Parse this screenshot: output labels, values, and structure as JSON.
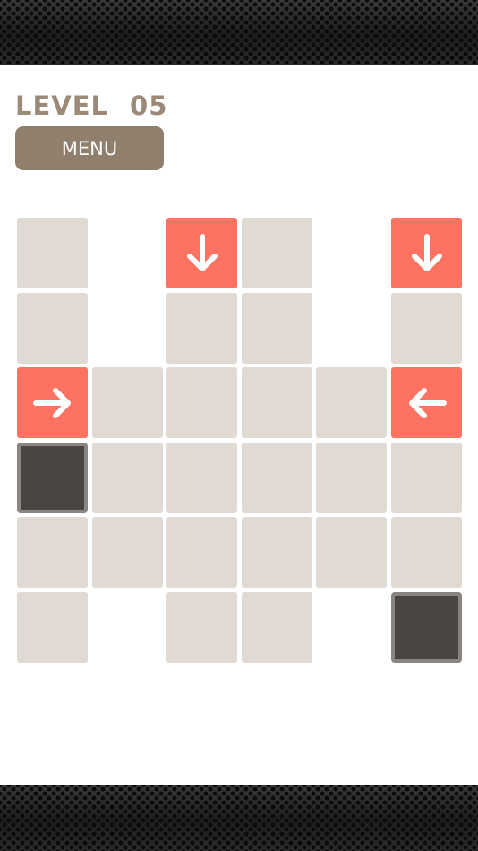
{
  "header": {
    "level_label": "LEVEL",
    "level_number": "05",
    "menu_label": "MENU"
  },
  "colors": {
    "empty_tile": "#e1dad3",
    "arrow_tile": "#fd7260",
    "dark_tile": "#4a4542",
    "text_brown": "#9b8a78",
    "menu_button": "#8f7f6c"
  },
  "board": {
    "cols": 6,
    "rows": 6,
    "tiles": [
      {
        "row": 0,
        "col": 0,
        "type": "empty"
      },
      {
        "row": 0,
        "col": 2,
        "type": "arrow",
        "direction": "down"
      },
      {
        "row": 0,
        "col": 3,
        "type": "empty"
      },
      {
        "row": 0,
        "col": 5,
        "type": "arrow",
        "direction": "down"
      },
      {
        "row": 1,
        "col": 0,
        "type": "empty"
      },
      {
        "row": 1,
        "col": 2,
        "type": "empty"
      },
      {
        "row": 1,
        "col": 3,
        "type": "empty"
      },
      {
        "row": 1,
        "col": 5,
        "type": "empty"
      },
      {
        "row": 2,
        "col": 0,
        "type": "arrow",
        "direction": "right"
      },
      {
        "row": 2,
        "col": 1,
        "type": "empty"
      },
      {
        "row": 2,
        "col": 2,
        "type": "empty"
      },
      {
        "row": 2,
        "col": 3,
        "type": "empty"
      },
      {
        "row": 2,
        "col": 4,
        "type": "empty"
      },
      {
        "row": 2,
        "col": 5,
        "type": "arrow",
        "direction": "left"
      },
      {
        "row": 3,
        "col": 0,
        "type": "dark"
      },
      {
        "row": 3,
        "col": 1,
        "type": "empty"
      },
      {
        "row": 3,
        "col": 2,
        "type": "empty"
      },
      {
        "row": 3,
        "col": 3,
        "type": "empty"
      },
      {
        "row": 3,
        "col": 4,
        "type": "empty"
      },
      {
        "row": 3,
        "col": 5,
        "type": "empty"
      },
      {
        "row": 4,
        "col": 0,
        "type": "empty"
      },
      {
        "row": 4,
        "col": 1,
        "type": "empty"
      },
      {
        "row": 4,
        "col": 2,
        "type": "empty"
      },
      {
        "row": 4,
        "col": 3,
        "type": "empty"
      },
      {
        "row": 4,
        "col": 4,
        "type": "empty"
      },
      {
        "row": 4,
        "col": 5,
        "type": "empty"
      },
      {
        "row": 5,
        "col": 0,
        "type": "empty"
      },
      {
        "row": 5,
        "col": 2,
        "type": "empty"
      },
      {
        "row": 5,
        "col": 3,
        "type": "empty"
      },
      {
        "row": 5,
        "col": 5,
        "type": "dark"
      }
    ]
  }
}
